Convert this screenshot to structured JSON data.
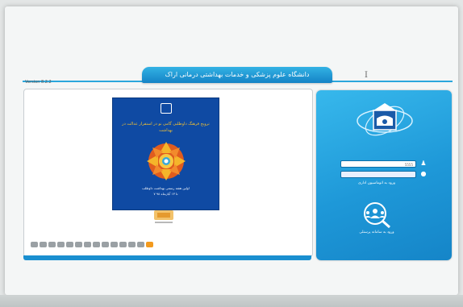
{
  "header": {
    "title": "دانشگاه علوم پزشکی و خدمات بهداشتی درمانی اراک",
    "version": "Version 8.2.2"
  },
  "slider": {
    "poster": {
      "title": "ترویج فرهنگ داوطلبی گامی نو در استقرار عدالت در بهداشت",
      "footer_line1": "اولین هفته رسمی بهداشت داوطلب",
      "footer_line2": "۷ تا ۱۳ آبان‌ماه ۹۸"
    },
    "dot_count": 14,
    "active_dot": 13
  },
  "login": {
    "username_value": "5555",
    "password_value": "",
    "submit_link": "ورود به اتوماسیون اداری",
    "portal_label": "ورود به سامانه پرسنلی"
  },
  "icons": {
    "user": "user-icon",
    "lock": "lock-icon",
    "logo": "university-logo-icon",
    "portal": "personnel-portal-icon"
  },
  "colors": {
    "accent": "#1e98d8",
    "banner": "#1483c6",
    "active_dot": "#f39a1e",
    "poster": "#0f4aa3"
  }
}
